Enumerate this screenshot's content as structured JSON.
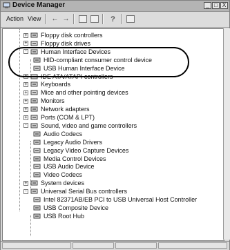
{
  "window": {
    "title": "Device Manager",
    "controls": [
      "_",
      "□",
      "X"
    ]
  },
  "menu": {
    "action_label": "Action",
    "view_label": "View"
  },
  "toolbar_icons": [
    "back-icon",
    "forward-icon",
    "properties-icon",
    "view-icon",
    "help-icon",
    "scan-icon"
  ],
  "tree": {
    "items": [
      {
        "label": "Floppy disk controllers",
        "icon": "floppy-controller-icon",
        "expander": "+"
      },
      {
        "label": "Floppy disk drives",
        "icon": "floppy-drive-icon",
        "expander": "+"
      },
      {
        "label": "Human Interface Devices",
        "icon": "hid-icon",
        "expander": "-"
      },
      {
        "label": "HID-compliant consumer control device",
        "icon": "hid-device-icon",
        "expander": ""
      },
      {
        "label": "USB Human Interface Device",
        "icon": "hid-device-icon",
        "expander": ""
      },
      {
        "label": "IDE ATA/ATAPI controllers",
        "icon": "ide-icon",
        "expander": "+"
      },
      {
        "label": "Keyboards",
        "icon": "keyboard-icon",
        "expander": "+"
      },
      {
        "label": "Mice and other pointing devices",
        "icon": "mouse-icon",
        "expander": "+"
      },
      {
        "label": "Monitors",
        "icon": "monitor-icon",
        "expander": "+"
      },
      {
        "label": "Network adapters",
        "icon": "network-icon",
        "expander": "+"
      },
      {
        "label": "Ports (COM & LPT)",
        "icon": "port-icon",
        "expander": "+"
      },
      {
        "label": "Sound, video and game controllers",
        "icon": "sound-icon",
        "expander": "-"
      },
      {
        "label": "Audio Codecs",
        "icon": "audio-icon",
        "expander": ""
      },
      {
        "label": "Legacy Audio Drivers",
        "icon": "audio-icon",
        "expander": ""
      },
      {
        "label": "Legacy Video Capture Devices",
        "icon": "audio-icon",
        "expander": ""
      },
      {
        "label": "Media Control Devices",
        "icon": "audio-icon",
        "expander": ""
      },
      {
        "label": "USB Audio Device",
        "icon": "audio-icon",
        "expander": ""
      },
      {
        "label": "Video Codecs",
        "icon": "audio-icon",
        "expander": ""
      },
      {
        "label": "System devices",
        "icon": "system-icon",
        "expander": "+"
      },
      {
        "label": "Universal Serial Bus controllers",
        "icon": "usb-icon",
        "expander": "-"
      },
      {
        "label": "Intel 82371AB/EB PCI to USB Universal Host Controller",
        "icon": "usb-icon",
        "expander": ""
      },
      {
        "label": "USB Composite Device",
        "icon": "usb-icon",
        "expander": ""
      },
      {
        "label": "USB Root Hub",
        "icon": "usb-icon",
        "expander": ""
      }
    ]
  }
}
